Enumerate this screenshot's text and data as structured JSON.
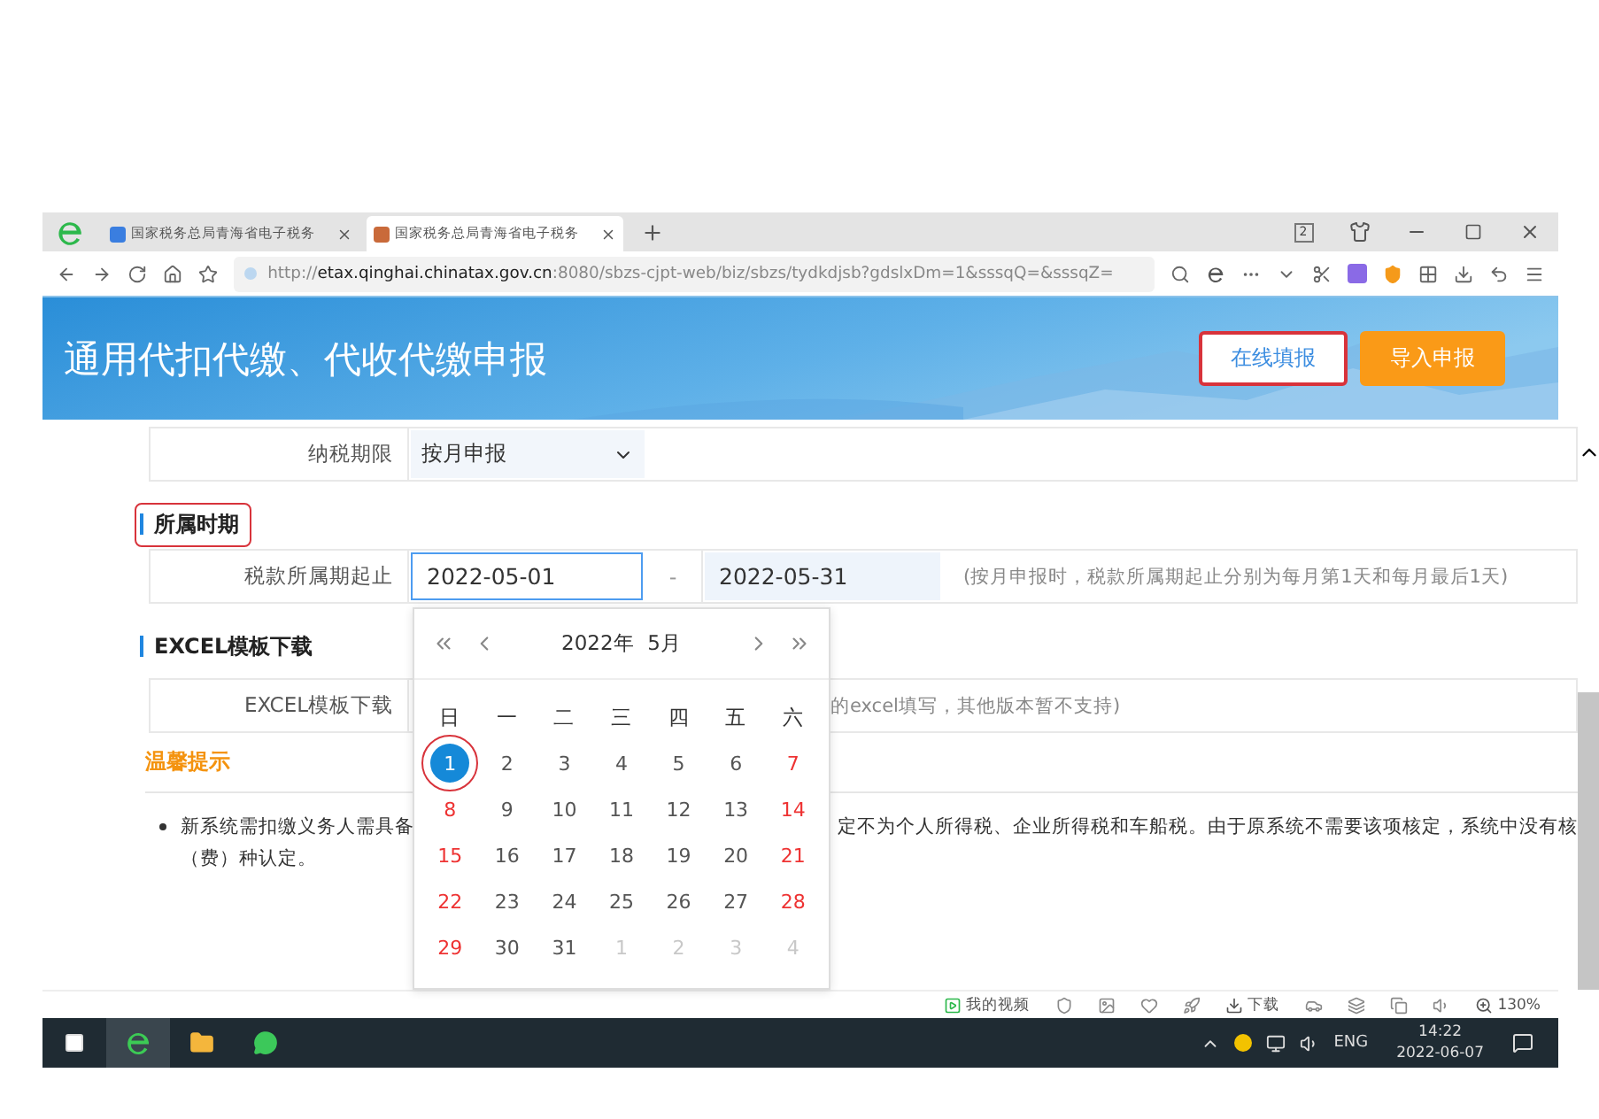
{
  "browser": {
    "tabs": [
      {
        "title": "国家税务总局青海省电子税务",
        "selected": false
      },
      {
        "title": "国家税务总局青海省电子税务",
        "selected": true
      }
    ],
    "window_count": "2",
    "url": "http://**etax.qinghai.chinatax.gov.cn**:8080/sbzs-cjpt-web/biz/sbzs/tydkdjsb?gdslxDm=1&sssqQ=&sssqZ="
  },
  "banner": {
    "title": "通用代扣代缴、代收代缴申报",
    "buttons": [
      {
        "label": "在线填报",
        "kind": "outline",
        "annotated": true
      },
      {
        "label": "导入申报",
        "kind": "filled",
        "annotated": false
      }
    ]
  },
  "form": {
    "period_row": {
      "label": "纳税期限",
      "value": "按月申报"
    },
    "period_section": {
      "title": "所属时期",
      "annotated": true
    },
    "date_row": {
      "label": "税款所属期起止",
      "start": "2022-05-01",
      "separator": "-",
      "end": "2022-05-31",
      "hint": "(按月申报时，税款所属期起止分别为每月第1天和每月最后1天)"
    },
    "excel_section": {
      "title": "EXCEL模板下载",
      "annotated": false
    },
    "excel_row": {
      "label": "EXCEL模板下载",
      "hint": "的excel填写，其他版本暂不支持)"
    },
    "tips": {
      "title": "温馨提示",
      "line_1_start": "新系统需扣缴义务人需具备",
      "line_1_end": "定不为个人所得税、企业所得税和车船税。由于原系统不需要该项核定，系统中没有核",
      "line_2": "（费）种认定。"
    }
  },
  "calendar": {
    "year": "2022年",
    "month": "5月",
    "weekdays": [
      {
        "label": "日",
        "weekend": false
      },
      {
        "label": "一",
        "weekend": false
      },
      {
        "label": "二",
        "weekend": false
      },
      {
        "label": "三",
        "weekend": false
      },
      {
        "label": "四",
        "weekend": false
      },
      {
        "label": "五",
        "weekend": false
      },
      {
        "label": "六",
        "weekend": false
      }
    ],
    "days": [
      {
        "label": "1",
        "kind": "current",
        "weekend": false,
        "selected": true,
        "annotated": true
      },
      {
        "label": "2",
        "kind": "current",
        "weekend": false,
        "selected": false,
        "annotated": false
      },
      {
        "label": "3",
        "kind": "current",
        "weekend": false,
        "selected": false,
        "annotated": false
      },
      {
        "label": "4",
        "kind": "current",
        "weekend": false,
        "selected": false,
        "annotated": false
      },
      {
        "label": "5",
        "kind": "current",
        "weekend": false,
        "selected": false,
        "annotated": false
      },
      {
        "label": "6",
        "kind": "current",
        "weekend": false,
        "selected": false,
        "annotated": false
      },
      {
        "label": "7",
        "kind": "current",
        "weekend": true,
        "selected": false,
        "annotated": false
      },
      {
        "label": "8",
        "kind": "current",
        "weekend": true,
        "selected": false,
        "annotated": false
      },
      {
        "label": "9",
        "kind": "current",
        "weekend": false,
        "selected": false,
        "annotated": false
      },
      {
        "label": "10",
        "kind": "current",
        "weekend": false,
        "selected": false,
        "annotated": false
      },
      {
        "label": "11",
        "kind": "current",
        "weekend": false,
        "selected": false,
        "annotated": false
      },
      {
        "label": "12",
        "kind": "current",
        "weekend": false,
        "selected": false,
        "annotated": false
      },
      {
        "label": "13",
        "kind": "current",
        "weekend": false,
        "selected": false,
        "annotated": false
      },
      {
        "label": "14",
        "kind": "current",
        "weekend": true,
        "selected": false,
        "annotated": false
      },
      {
        "label": "15",
        "kind": "current",
        "weekend": true,
        "selected": false,
        "annotated": false
      },
      {
        "label": "16",
        "kind": "current",
        "weekend": false,
        "selected": false,
        "annotated": false
      },
      {
        "label": "17",
        "kind": "current",
        "weekend": false,
        "selected": false,
        "annotated": false
      },
      {
        "label": "18",
        "kind": "current",
        "weekend": false,
        "selected": false,
        "annotated": false
      },
      {
        "label": "19",
        "kind": "current",
        "weekend": false,
        "selected": false,
        "annotated": false
      },
      {
        "label": "20",
        "kind": "current",
        "weekend": false,
        "selected": false,
        "annotated": false
      },
      {
        "label": "21",
        "kind": "current",
        "weekend": true,
        "selected": false,
        "annotated": false
      },
      {
        "label": "22",
        "kind": "current",
        "weekend": true,
        "selected": false,
        "annotated": false
      },
      {
        "label": "23",
        "kind": "current",
        "weekend": false,
        "selected": false,
        "annotated": false
      },
      {
        "label": "24",
        "kind": "current",
        "weekend": false,
        "selected": false,
        "annotated": false
      },
      {
        "label": "25",
        "kind": "current",
        "weekend": false,
        "selected": false,
        "annotated": false
      },
      {
        "label": "26",
        "kind": "current",
        "weekend": false,
        "selected": false,
        "annotated": false
      },
      {
        "label": "27",
        "kind": "current",
        "weekend": false,
        "selected": false,
        "annotated": false
      },
      {
        "label": "28",
        "kind": "current",
        "weekend": true,
        "selected": false,
        "annotated": false
      },
      {
        "label": "29",
        "kind": "current",
        "weekend": true,
        "selected": false,
        "annotated": false
      },
      {
        "label": "30",
        "kind": "current",
        "weekend": false,
        "selected": false,
        "annotated": false
      },
      {
        "label": "31",
        "kind": "current",
        "weekend": false,
        "selected": false,
        "annotated": false
      },
      {
        "label": "1",
        "kind": "other",
        "weekend": false,
        "selected": false,
        "annotated": false
      },
      {
        "label": "2",
        "kind": "other",
        "weekend": false,
        "selected": false,
        "annotated": false
      },
      {
        "label": "3",
        "kind": "other",
        "weekend": false,
        "selected": false,
        "annotated": false
      },
      {
        "label": "4",
        "kind": "other",
        "weekend": false,
        "selected": false,
        "annotated": false
      }
    ]
  },
  "status_bar": {
    "video": "我的视频",
    "download": "下载",
    "zoom": "130%"
  },
  "taskbar": {
    "language": "ENG",
    "time": "14:22",
    "date": "2022-06-07"
  }
}
